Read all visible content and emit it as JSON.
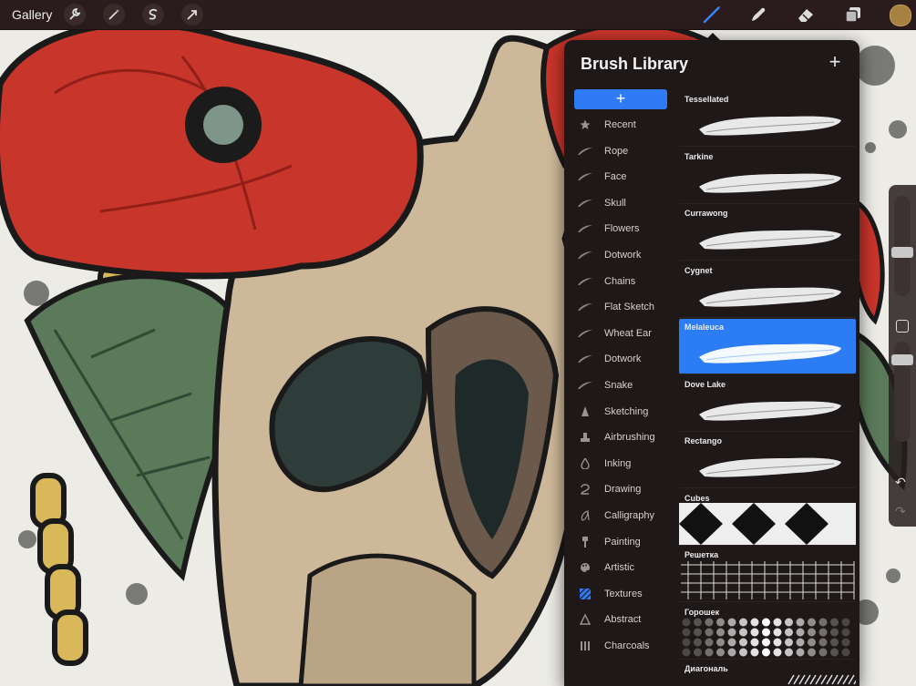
{
  "toolbar": {
    "gallery_label": "Gallery",
    "left_tools": [
      "wrench-icon",
      "magic-wand-icon",
      "selection-icon",
      "transform-icon"
    ],
    "right_tools": [
      "brush-icon",
      "smudge-icon",
      "eraser-icon",
      "layers-icon"
    ],
    "active_tool": "brush-icon",
    "current_color": "#a7813f"
  },
  "panel": {
    "title": "Brush Library",
    "add_label": "+",
    "new_set_label": "+"
  },
  "categories": [
    {
      "label": "Recent",
      "icon": "star-icon"
    },
    {
      "label": "Rope",
      "icon": "stroke-icon"
    },
    {
      "label": "Face",
      "icon": "stroke-icon"
    },
    {
      "label": "Skull",
      "icon": "stroke-icon"
    },
    {
      "label": "Flowers",
      "icon": "stroke-icon"
    },
    {
      "label": "Dotwork",
      "icon": "stroke-icon"
    },
    {
      "label": "Chains",
      "icon": "stroke-icon"
    },
    {
      "label": "Flat Sketch",
      "icon": "stroke-icon"
    },
    {
      "label": "Wheat Ear",
      "icon": "stroke-icon"
    },
    {
      "label": "Dotwork",
      "icon": "stroke-icon"
    },
    {
      "label": "Snake",
      "icon": "stroke-icon"
    },
    {
      "label": "Sketching",
      "icon": "pencil-tip-icon"
    },
    {
      "label": "Airbrushing",
      "icon": "airbrush-icon"
    },
    {
      "label": "Inking",
      "icon": "ink-drop-icon"
    },
    {
      "label": "Drawing",
      "icon": "swirl-icon"
    },
    {
      "label": "Calligraphy",
      "icon": "calligraphy-icon"
    },
    {
      "label": "Painting",
      "icon": "paint-brush-icon"
    },
    {
      "label": "Artistic",
      "icon": "palette-icon"
    },
    {
      "label": "Textures",
      "icon": "texture-icon"
    },
    {
      "label": "Abstract",
      "icon": "triangle-icon"
    },
    {
      "label": "Charcoals",
      "icon": "charcoal-icon"
    }
  ],
  "brushes": [
    {
      "name": "Tessellated",
      "selected": false
    },
    {
      "name": "Tarkine",
      "selected": false
    },
    {
      "name": "Currawong",
      "selected": false
    },
    {
      "name": "Cygnet",
      "selected": false
    },
    {
      "name": "Melaleuca",
      "selected": true
    },
    {
      "name": "Dove Lake",
      "selected": false
    },
    {
      "name": "Rectango",
      "selected": false
    },
    {
      "name": "Cubes",
      "selected": false
    },
    {
      "name": "Решетка",
      "selected": false
    },
    {
      "name": "Горошек",
      "selected": false
    },
    {
      "name": "Диагональ",
      "selected": false
    }
  ],
  "colors": {
    "accent": "#2f7af5",
    "panel_bg": "#1e1818",
    "toolbar_bg": "#2a1c1c"
  }
}
